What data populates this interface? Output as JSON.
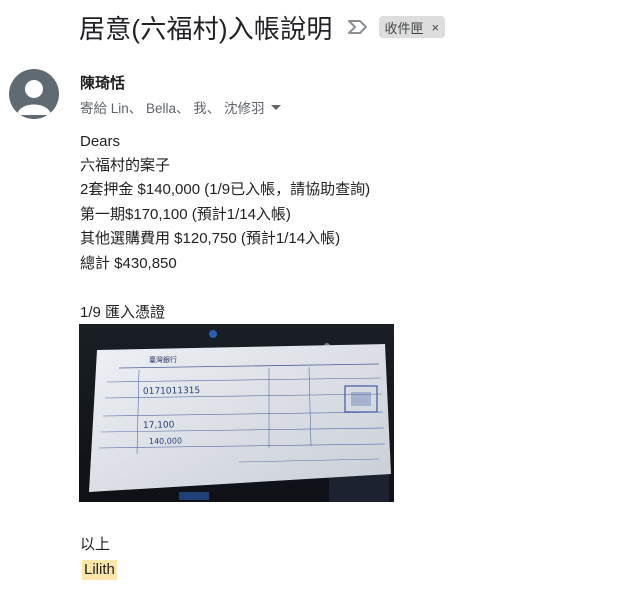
{
  "email": {
    "subject": "居意(六福村)入帳說明",
    "label_chip": "收件匣",
    "label_chip_close": "×",
    "sender_name": "陳琦恬",
    "recipients": "寄給 Lin、 Bella、 我、 沈修羽"
  },
  "body": {
    "lines": [
      "Dears",
      "六福村的案子",
      "2套押金 $140,000 (1/9已入帳，請協助查詢)",
      "第一期$170,100  (預計1/14入帳)",
      "其他選購費用 $120,750 (預計1/14入帳)",
      "總計 $430,850"
    ],
    "attachment_caption": "1/9 匯入憑證",
    "closing": "以上",
    "signature": "Lilith"
  },
  "receipt_image": {
    "bank_name": "臺灣銀行",
    "handwritten_values": [
      "0171011315",
      "17,100",
      "140,000"
    ]
  },
  "colors": {
    "chip_background": "#dddddd",
    "signature_highlight": "#fbe5a8",
    "avatar_background": "#606a73"
  },
  "icons": {
    "importance": "importance-marker-icon",
    "avatar": "default-avatar-icon",
    "recipients_toggle": "chevron-down-icon"
  }
}
